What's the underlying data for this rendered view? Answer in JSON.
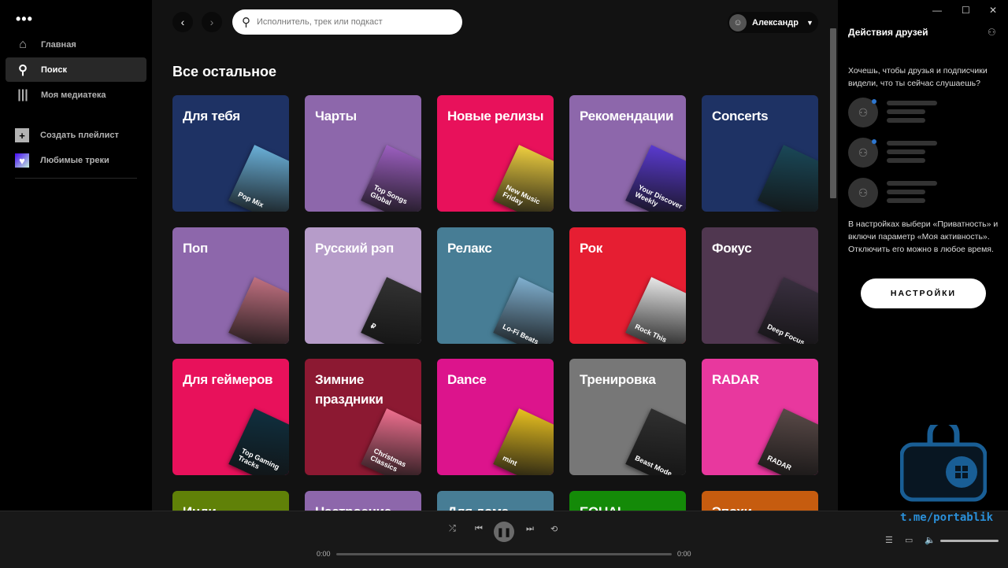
{
  "sidebar": {
    "menu_icon": "more-dots-icon",
    "items": [
      {
        "label": "Главная",
        "icon": "home-icon"
      },
      {
        "label": "Поиск",
        "icon": "search-icon",
        "active": true
      },
      {
        "label": "Моя медиатека",
        "icon": "library-icon"
      }
    ],
    "create_playlist": "Создать плейлист",
    "liked": "Любимые треки"
  },
  "header": {
    "search_placeholder": "Исполнитель, трек или подкаст",
    "user": "Александр"
  },
  "main": {
    "section_title": "Все остальное",
    "cards": [
      {
        "title": "Для тебя",
        "color": "#1e3264",
        "art": "Pop Mix",
        "art_color": "#6ab0d8"
      },
      {
        "title": "Чарты",
        "color": "#8d67ab",
        "art": "Top Songs Global",
        "art_color": "#9c5fc0"
      },
      {
        "title": "Новые релизы",
        "color": "#e8115b",
        "art": "New Music Friday",
        "art_color": "#f0d040"
      },
      {
        "title": "Рекомендации",
        "color": "#8d67ab",
        "art": "Your Discover Weekly",
        "art_color": "#5a3ad0"
      },
      {
        "title": "Concerts",
        "color": "#1e3264",
        "art": "",
        "art_color": "#1a4858"
      },
      {
        "title": "Поп",
        "color": "#8d67ab",
        "art": "",
        "art_color": "#c07080"
      },
      {
        "title": "Русский рэп",
        "color": "#b69cc9",
        "art": "₽",
        "art_color": "#333333"
      },
      {
        "title": "Релакс",
        "color": "#477d95",
        "art": "Lo-Fi Beats",
        "art_color": "#80b0d0"
      },
      {
        "title": "Рок",
        "color": "#e61e32",
        "art": "Rock This",
        "art_color": "#e8e8e8"
      },
      {
        "title": "Фокус",
        "color": "#503750",
        "art": "Deep Focus",
        "art_color": "#3a3040"
      },
      {
        "title": "Для геймеров",
        "color": "#e8115b",
        "art": "Top Gaming Tracks",
        "art_color": "#103040"
      },
      {
        "title": "Зимние праздники",
        "color": "#8c1932",
        "art": "Christmas Classics",
        "art_color": "#f07090"
      },
      {
        "title": "Dance",
        "color": "#dc148c",
        "art": "mint",
        "art_color": "#e8c020"
      },
      {
        "title": "Тренировка",
        "color": "#777777",
        "art": "Beast Mode",
        "art_color": "#303030"
      },
      {
        "title": "RADAR",
        "color": "#e8389e",
        "art": "RADAR",
        "art_color": "#5a4a48"
      },
      {
        "title": "Инди",
        "color": "#608108",
        "art": "",
        "art_color": "#608108"
      },
      {
        "title": "Настроение",
        "color": "#8d67ab",
        "art": "",
        "art_color": "#8d67ab"
      },
      {
        "title": "Для дома",
        "color": "#477d95",
        "art": "",
        "art_color": "#477d95"
      },
      {
        "title": "EQUAL",
        "color": "#148a08",
        "art": "",
        "art_color": "#148a08"
      },
      {
        "title": "Эпохи",
        "color": "#c65c0f",
        "art": "",
        "art_color": "#c65c0f"
      }
    ]
  },
  "friends": {
    "title": "Действия друзей",
    "question": "Хочешь, чтобы друзья и подписчики видели, что ты сейчас слушаешь?",
    "info": "В настройках выбери «Приватность» и включи параметр «Моя активность». Отключить его можно в любое время.",
    "button": "НАСТРОЙКИ"
  },
  "player": {
    "elapsed": "0:00",
    "duration": "0:00",
    "progress": 0,
    "volume": 1.0
  },
  "watermark": "t.me/portablik"
}
